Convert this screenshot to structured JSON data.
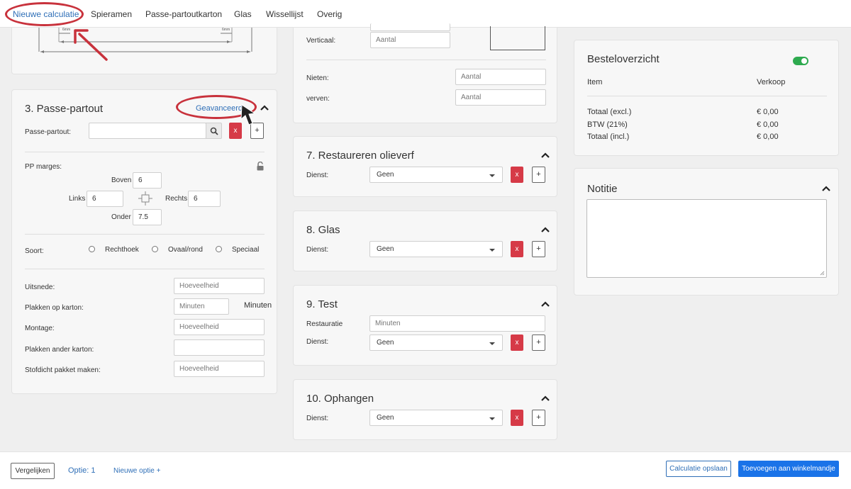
{
  "nav": {
    "tabs": [
      "Nieuwe calculatie",
      "Spieramen",
      "Passe-partoutkarton",
      "Glas",
      "Wissellijst",
      "Overig"
    ],
    "active_index": 0
  },
  "diagram": {
    "left_mm": "6mm",
    "right_mm": "6mm"
  },
  "passe_partout": {
    "title": "3. Passe-partout",
    "advanced_link": "Geavanceerd",
    "pp_label": "Passe-partout:",
    "remove_label": "x",
    "add_label": "+",
    "margins_label": "PP marges:",
    "top_label": "Boven",
    "top_value": "6",
    "left_label": "Links",
    "left_value": "6",
    "right_label": "Rechts",
    "right_value": "6",
    "bottom_label": "Onder",
    "bottom_value": "7.5",
    "sort_label": "Soort:",
    "sort_options": [
      "Rechthoek",
      "Ovaal/rond",
      "Speciaal"
    ],
    "fields": [
      {
        "label": "Uitsnede:",
        "placeholder": "Hoeveelheid"
      },
      {
        "label": "Plakken op karton:",
        "placeholder": "Minuten",
        "suffix": "Minuten"
      },
      {
        "label": "Montage:",
        "placeholder": "Hoeveelheid"
      },
      {
        "label": "Plakken ander karton:",
        "placeholder": ""
      },
      {
        "label": "Stofdicht pakket maken:",
        "placeholder": "Hoeveelheid"
      }
    ]
  },
  "misc_card": {
    "vertical_label": "Verticaal:",
    "vertical_placeholder": "Aantal",
    "nieten_label": "Nieten:",
    "nieten_placeholder": "Aantal",
    "verven_label": "verven:",
    "verven_placeholder": "Aantal"
  },
  "services": [
    {
      "title": "7. Restaureren olieverf",
      "dienst_label": "Dienst:",
      "value": "Geen"
    },
    {
      "title": "8. Glas",
      "dienst_label": "Dienst:",
      "value": "Geen"
    },
    {
      "title": "9. Test",
      "restauratie_label": "Restauratie",
      "restauratie_placeholder": "Minuten",
      "dienst_label": "Dienst:",
      "value": "Geen"
    },
    {
      "title": "10. Ophangen",
      "dienst_label": "Dienst:",
      "value": "Geen"
    }
  ],
  "order_summary": {
    "title": "Besteloverzicht",
    "col_item": "Item",
    "col_sale": "Verkoop",
    "rows": [
      {
        "label": "Totaal (excl.)",
        "value": "€ 0,00"
      },
      {
        "label": "BTW (21%)",
        "value": "€ 0,00"
      },
      {
        "label": "Totaal (incl.)",
        "value": "€ 0,00"
      }
    ],
    "toggle_on": true
  },
  "notes": {
    "title": "Notitie",
    "value": ""
  },
  "bottom": {
    "compare": "Vergelijken",
    "option": "Optie: 1",
    "new_option": "Nieuwe optie +",
    "save": "Calculatie opslaan",
    "add_to_cart": "Toevoegen aan winkelmandje"
  },
  "colors": {
    "accent": "#2f6fb7",
    "danger": "#d63a47",
    "toggle": "#2eaa4f",
    "annotation": "#c8323c"
  }
}
